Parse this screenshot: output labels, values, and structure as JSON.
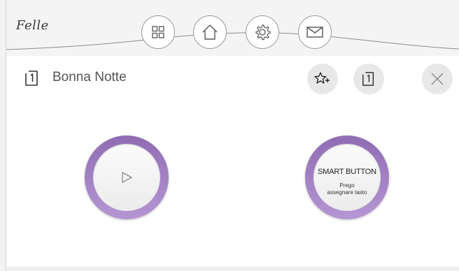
{
  "header": {
    "logo_text": "Felle",
    "nav": [
      {
        "name": "apps-grid-icon"
      },
      {
        "name": "home-icon"
      },
      {
        "name": "gear-icon"
      },
      {
        "name": "mail-icon"
      }
    ]
  },
  "panel": {
    "title": "Bonna Notte",
    "title_icon": "scene-door-1-icon",
    "actions": [
      {
        "name": "add-favorite-icon"
      },
      {
        "name": "scene-door-1-icon"
      },
      {
        "name": "close-icon"
      }
    ]
  },
  "buttons": {
    "play_icon": "play-icon",
    "smart_label": "SMART BUTTON",
    "smart_hint_line1": "Prego",
    "smart_hint_line2": "assegnare tasto"
  },
  "colors": {
    "ring_top": "#8f6cb3",
    "ring_bottom": "#b596d3",
    "panel_bg": "#ffffff",
    "page_bg": "#f2f2f2"
  }
}
